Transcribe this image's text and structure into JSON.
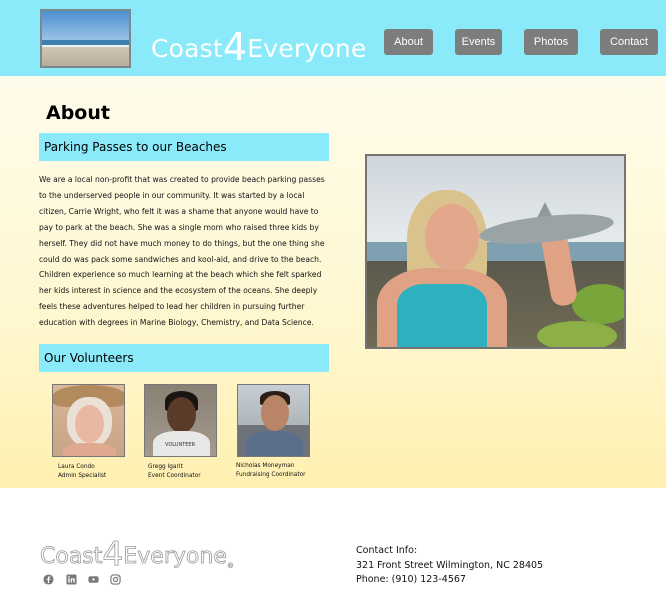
{
  "header": {
    "logo_prefix": "Coast",
    "logo_four": "4",
    "logo_suffix": "Everyone",
    "nav": [
      {
        "label": "About"
      },
      {
        "label": "Events"
      },
      {
        "label": "Photos"
      },
      {
        "label": "Contact"
      }
    ]
  },
  "main": {
    "title": "About",
    "about_heading": "Parking Passes to our Beaches",
    "about_text": "We are a local non-profit that was created to provide beach parking passes to the underserved people in our community. It was started by a local citizen, Carrie Wright, who felt it was a shame that anyone would have to pay to park at the beach. She was a single mom who raised three kids by herself. They did not have much money to do things, but the one thing she could do was pack some sandwiches and kool-aid, and drive to the beach. Children experience so much learning at the beach which she felt sparked her kids interest in science and the ecosystem of the oceans. She deeply feels these adventures helped to lead her children in pursuing further education with degrees in Marine Biology, Chemistry, and Data Science.",
    "volunteers_heading": "Our Volunteers",
    "volunteers": [
      {
        "name": "Laura Condo",
        "role": "Admin Specialist"
      },
      {
        "name": "Gregg Igarit",
        "role": "Event Coordinator"
      },
      {
        "name": "Nicholas Moneyman",
        "role": "Fundraising Coordinator"
      }
    ],
    "shirt_text": "VOLUNTEER"
  },
  "footer": {
    "logo_prefix": "Coast",
    "logo_four": "4",
    "logo_suffix": "Everyone",
    "logo_reg": "®",
    "social_icons": [
      "facebook-icon",
      "linkedin-icon",
      "youtube-icon",
      "instagram-icon"
    ],
    "contact_title": "Contact Info:",
    "address": "321 Front Street Wilmington, NC 28405",
    "phone": "Phone: (910) 123-4567"
  },
  "colors": {
    "header_bg": "#8aeafa",
    "nav_button": "#7c7d7d",
    "section_bar": "#8aeafa",
    "main_bg_top": "#fffbeb",
    "main_bg_bottom": "#fff0b0"
  }
}
